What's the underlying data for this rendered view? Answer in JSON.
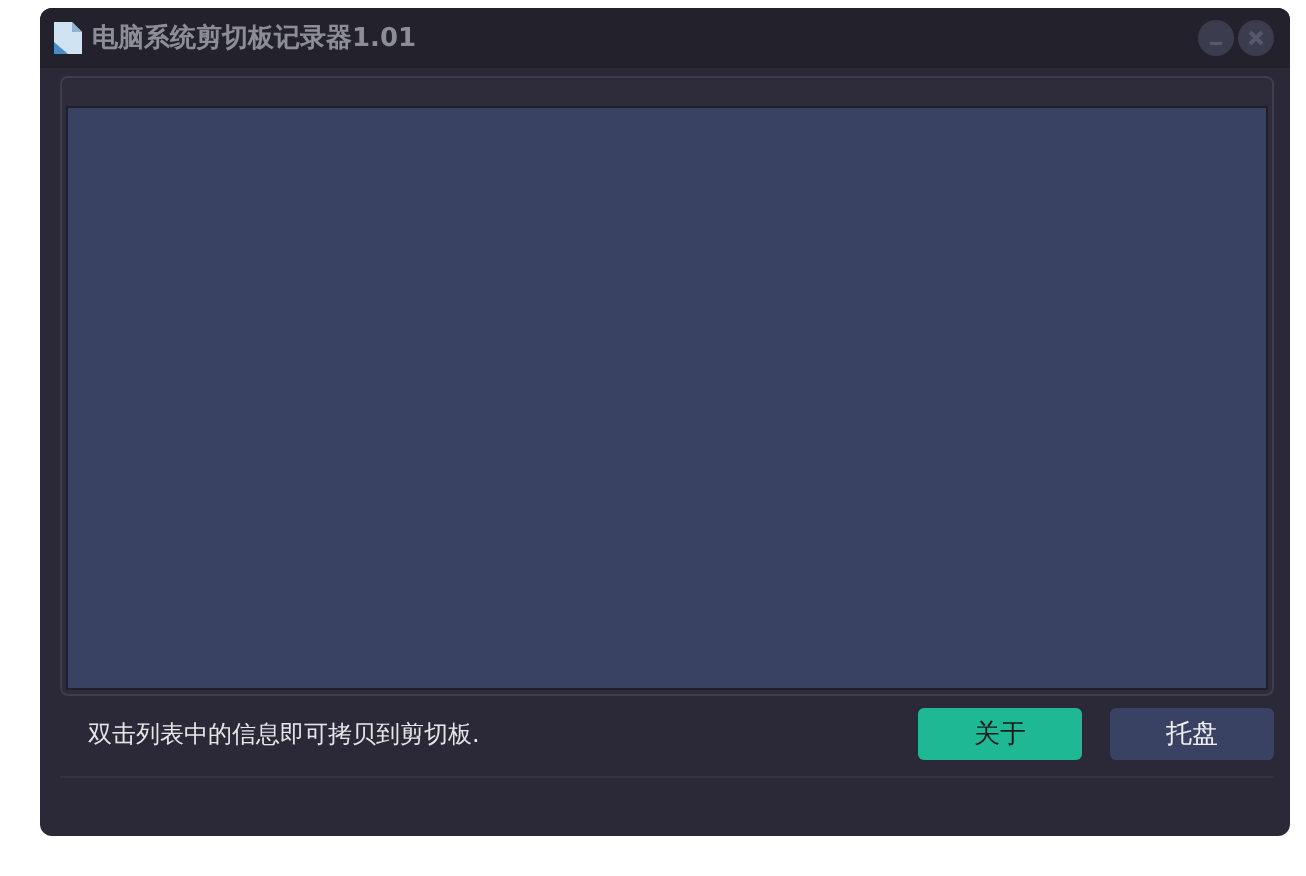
{
  "window": {
    "title": "电脑系统剪切板记录器1.01"
  },
  "status": {
    "hint": "双击列表中的信息即可拷贝到剪切板."
  },
  "buttons": [
    {
      "label": "关于",
      "kind": "primary"
    },
    {
      "label": "托盘",
      "kind": "secondary"
    }
  ]
}
